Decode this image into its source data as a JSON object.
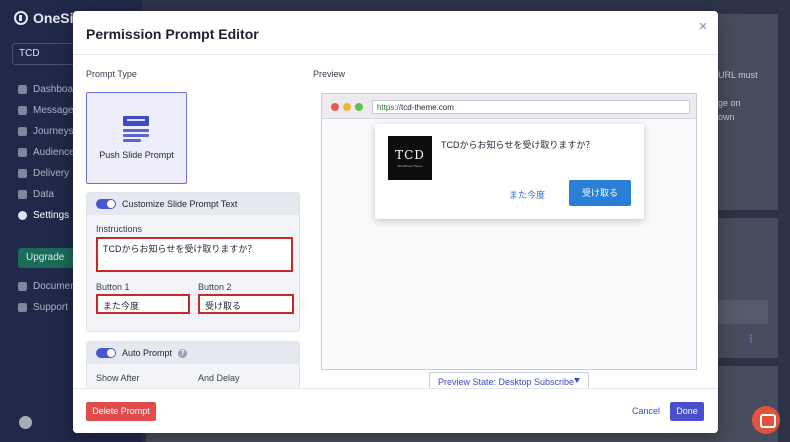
{
  "app": {
    "logo_text": "OneSig",
    "org": "TCD",
    "nav": [
      {
        "label": "Dashboard",
        "icon": "dashboard-icon"
      },
      {
        "label": "Messages",
        "icon": "messages-icon"
      },
      {
        "label": "Journeys",
        "icon": "journeys-icon"
      },
      {
        "label": "Audience",
        "icon": "audience-icon"
      },
      {
        "label": "Delivery",
        "icon": "delivery-icon"
      },
      {
        "label": "Data",
        "icon": "data-icon"
      },
      {
        "label": "Settings",
        "icon": "gear-icon",
        "active": true
      }
    ],
    "upgrade_label": "Upgrade",
    "bottom_nav": [
      {
        "label": "Document",
        "icon": "document-icon"
      },
      {
        "label": "Support",
        "icon": "support-icon"
      }
    ],
    "background_text": {
      "line1": "URL must",
      "line2": "ge on",
      "line3": "own"
    },
    "menu_dots": "⋮"
  },
  "modal": {
    "title": "Permission Prompt Editor",
    "close_label": "×",
    "prompt_type_label": "Prompt Type",
    "prompt_type_option": "Push Slide Prompt",
    "customize": {
      "toggle_label": "Customize Slide Prompt Text",
      "instructions_label": "Instructions",
      "instructions_value": "TCDからお知らせを受け取りますか？",
      "button1_label": "Button 1",
      "button1_value": "また今度",
      "button2_label": "Button 2",
      "button2_value": "受け取る"
    },
    "auto_prompt": {
      "toggle_label": "Auto Prompt",
      "help": "?",
      "show_after_label": "Show After",
      "delay_label": "And Delay"
    },
    "preview": {
      "label": "Preview",
      "url_scheme": "https://",
      "url_host": "tcd-theme.com",
      "logo_big": "TCD",
      "logo_small": "WordPress Theme",
      "message": "TCDからお知らせを受け取りますか？",
      "button1": "また今度",
      "button2": "受け取る",
      "state_label": "Preview State: Desktop Subscribe"
    },
    "footer": {
      "delete_label": "Delete Prompt",
      "cancel_label": "Cancel",
      "done_label": "Done"
    }
  },
  "colors": {
    "accent": "#4a4fcf",
    "danger": "#e04b4b",
    "highlight_border": "#c8282a",
    "preview_button": "#2a7fd8",
    "sidebar_bg": "#21294a"
  }
}
